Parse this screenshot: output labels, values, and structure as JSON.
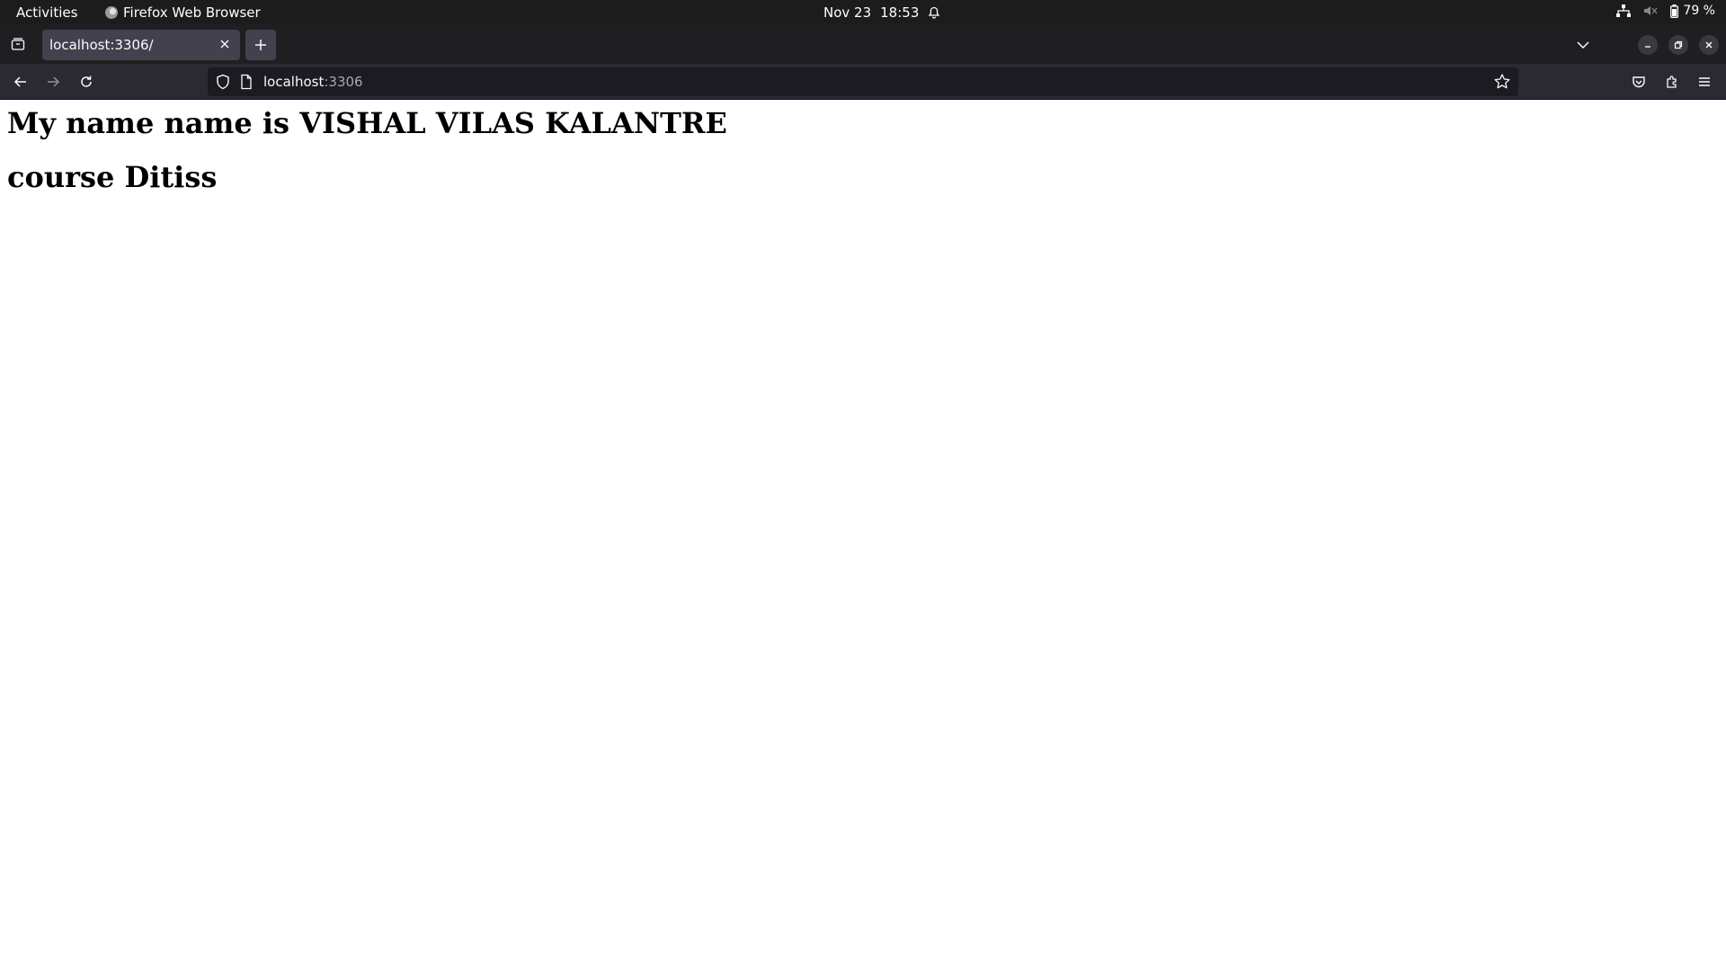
{
  "topbar": {
    "activities": "Activities",
    "app_name": "Firefox Web Browser",
    "date": "Nov 23",
    "time": "18:53",
    "battery": "79 %"
  },
  "tabs": [
    {
      "title": "localhost:3306/",
      "active": true
    }
  ],
  "urlbar": {
    "host": "localhost",
    "port": ":3306"
  },
  "page": {
    "heading1": "My name name is VISHAL VILAS KALANTRE",
    "heading2": "course Ditiss"
  },
  "icons": {
    "tab_overview": "tab-overview-icon",
    "new_tab": "plus-icon",
    "back": "arrow-left-icon",
    "forward": "arrow-right-icon",
    "reload": "reload-icon",
    "shield": "shield-icon",
    "page": "page-icon",
    "bookmark": "star-icon",
    "pocket": "pocket-icon",
    "extensions": "puzzle-icon",
    "menu": "hamburger-icon"
  },
  "colors": {
    "topbar_bg": "#1c1c1c",
    "tabstrip_bg": "#1f1f22",
    "active_tab_bg": "#42414d",
    "toolbar_bg": "#2b2a33",
    "urlbar_bg": "#1c1b22",
    "page_bg": "#ffffff"
  }
}
